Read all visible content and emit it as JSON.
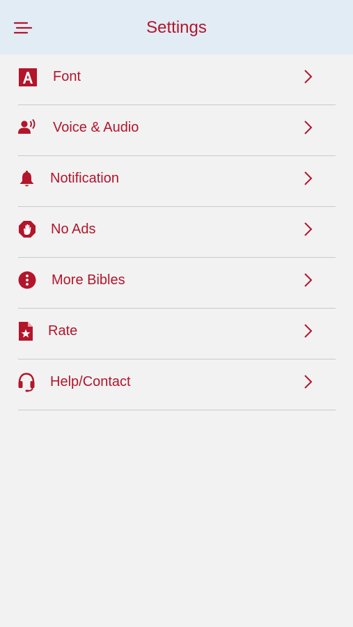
{
  "header": {
    "title": "Settings",
    "menu_icon": "hamburger-menu-icon"
  },
  "colors": {
    "accent": "#b3152b",
    "header_bg": "#e1ecf5",
    "page_bg": "#f2f2f2",
    "divider": "#c9c9c9"
  },
  "settings": {
    "items": [
      {
        "label": "Font",
        "icon": "font-icon"
      },
      {
        "label": "Voice & Audio",
        "icon": "voice-audio-icon"
      },
      {
        "label": "Notification",
        "icon": "bell-icon"
      },
      {
        "label": "No Ads",
        "icon": "no-ads-hand-icon"
      },
      {
        "label": "More Bibles",
        "icon": "info-exclamation-icon"
      },
      {
        "label": "Rate",
        "icon": "star-document-icon"
      },
      {
        "label": "Help/Contact",
        "icon": "headset-icon"
      }
    ]
  }
}
